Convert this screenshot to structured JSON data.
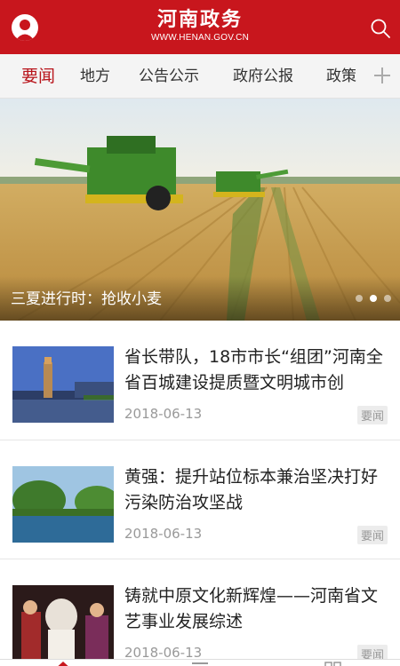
{
  "header": {
    "title": "河南政务",
    "subtitle": "WWW.HENAN.GOV.CN",
    "avatar_icon": "user-avatar-icon",
    "search_icon": "search-icon"
  },
  "tabs": [
    {
      "label": "要闻",
      "active": true
    },
    {
      "label": "地方",
      "active": false
    },
    {
      "label": "公告公示",
      "active": false
    },
    {
      "label": "政府公报",
      "active": false
    },
    {
      "label": "政策",
      "active": false
    }
  ],
  "banner": {
    "caption": "三夏进行时：抢收小麦",
    "slide_count": 3,
    "active_slide": 2
  },
  "news": [
    {
      "title": "省长带队，18市市长“组团”河南全省百城建设提质暨文明城市创",
      "date": "2018-06-13",
      "tag": "要闻"
    },
    {
      "title": "黄强：提升站位标本兼治坚决打好污染防治攻坚战",
      "date": "2018-06-13",
      "tag": "要闻"
    },
    {
      "title": "铸就中原文化新辉煌——河南省文艺事业发展综述",
      "date": "2018-06-13",
      "tag": "要闻"
    }
  ],
  "colors": {
    "brand_red": "#c8161d",
    "active_tab": "#b8141b",
    "tab_bar_bg": "#f4f4f4",
    "meta_gray": "#999999"
  }
}
